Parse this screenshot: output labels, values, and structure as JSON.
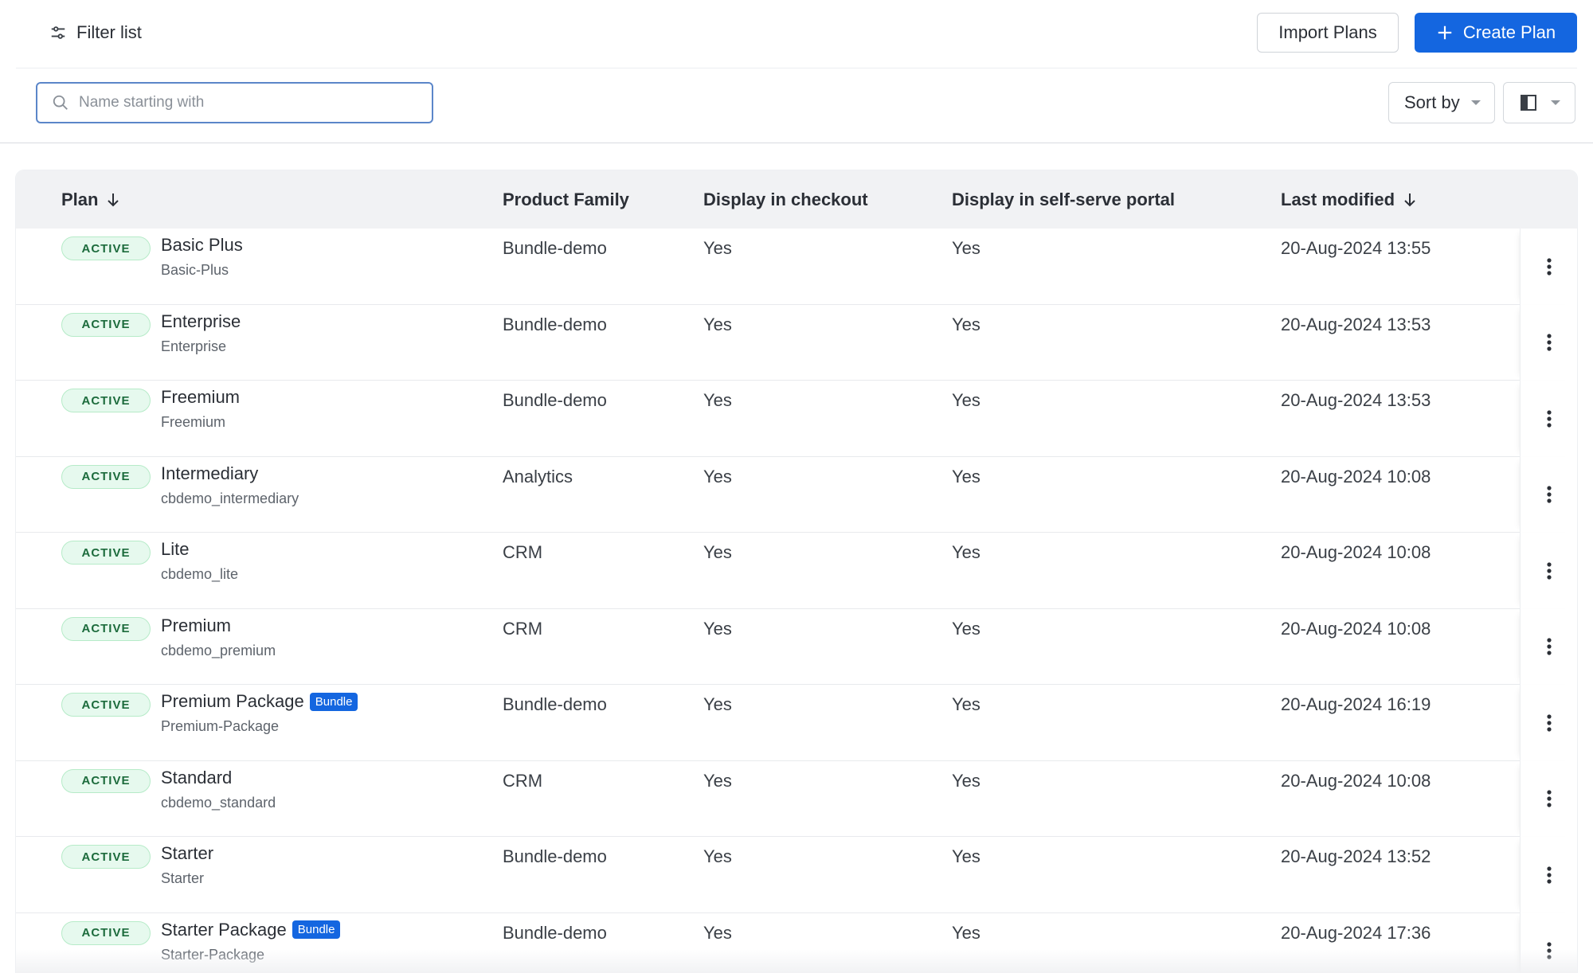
{
  "header": {
    "filter_label": "Filter list",
    "import_label": "Import Plans",
    "create_label": "Create Plan"
  },
  "toolbar": {
    "search_placeholder": "Name starting with",
    "sort_label": "Sort by"
  },
  "colors": {
    "primary": "#1466e0",
    "active_badge_bg": "#e6f9ee",
    "active_badge_text": "#1c6b3c"
  },
  "table": {
    "columns": {
      "plan": "Plan",
      "family": "Product Family",
      "checkout": "Display in checkout",
      "portal": "Display in self-serve portal",
      "modified": "Last modified"
    },
    "rows": [
      {
        "status": "ACTIVE",
        "name": "Basic Plus",
        "id": "Basic-Plus",
        "tag": "",
        "family": "Bundle-demo",
        "checkout": "Yes",
        "portal": "Yes",
        "modified": "20-Aug-2024 13:55"
      },
      {
        "status": "ACTIVE",
        "name": "Enterprise",
        "id": "Enterprise",
        "tag": "",
        "family": "Bundle-demo",
        "checkout": "Yes",
        "portal": "Yes",
        "modified": "20-Aug-2024 13:53"
      },
      {
        "status": "ACTIVE",
        "name": "Freemium",
        "id": "Freemium",
        "tag": "",
        "family": "Bundle-demo",
        "checkout": "Yes",
        "portal": "Yes",
        "modified": "20-Aug-2024 13:53"
      },
      {
        "status": "ACTIVE",
        "name": "Intermediary",
        "id": "cbdemo_intermediary",
        "tag": "",
        "family": "Analytics",
        "checkout": "Yes",
        "portal": "Yes",
        "modified": "20-Aug-2024 10:08"
      },
      {
        "status": "ACTIVE",
        "name": "Lite",
        "id": "cbdemo_lite",
        "tag": "",
        "family": "CRM",
        "checkout": "Yes",
        "portal": "Yes",
        "modified": "20-Aug-2024 10:08"
      },
      {
        "status": "ACTIVE",
        "name": "Premium",
        "id": "cbdemo_premium",
        "tag": "",
        "family": "CRM",
        "checkout": "Yes",
        "portal": "Yes",
        "modified": "20-Aug-2024 10:08"
      },
      {
        "status": "ACTIVE",
        "name": "Premium Package",
        "id": "Premium-Package",
        "tag": "Bundle",
        "family": "Bundle-demo",
        "checkout": "Yes",
        "portal": "Yes",
        "modified": "20-Aug-2024 16:19"
      },
      {
        "status": "ACTIVE",
        "name": "Standard",
        "id": "cbdemo_standard",
        "tag": "",
        "family": "CRM",
        "checkout": "Yes",
        "portal": "Yes",
        "modified": "20-Aug-2024 10:08"
      },
      {
        "status": "ACTIVE",
        "name": "Starter",
        "id": "Starter",
        "tag": "",
        "family": "Bundle-demo",
        "checkout": "Yes",
        "portal": "Yes",
        "modified": "20-Aug-2024 13:52"
      },
      {
        "status": "ACTIVE",
        "name": "Starter Package",
        "id": "Starter-Package",
        "tag": "Bundle",
        "family": "Bundle-demo",
        "checkout": "Yes",
        "portal": "Yes",
        "modified": "20-Aug-2024 17:36"
      }
    ]
  }
}
